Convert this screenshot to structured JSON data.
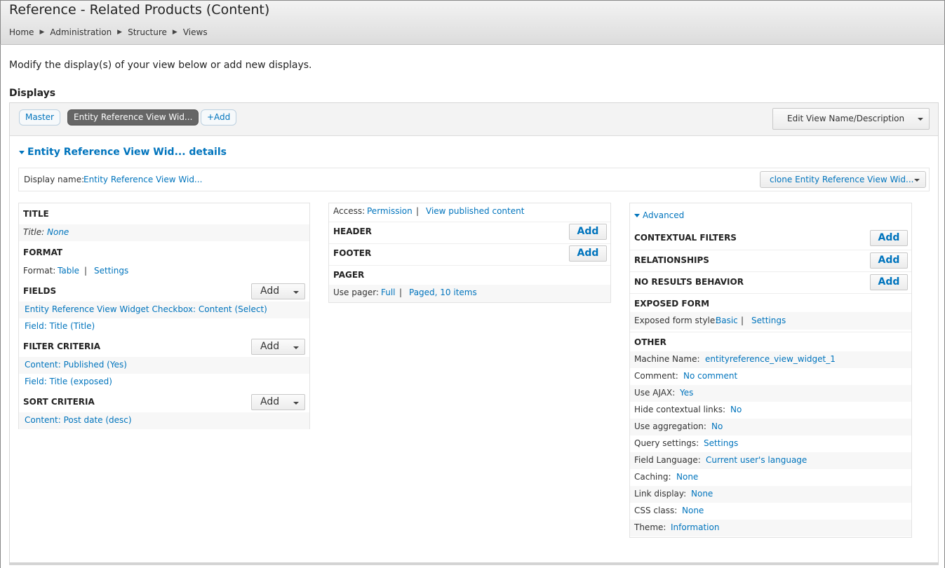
{
  "header": {
    "title": "Reference - Related Products (Content)",
    "breadcrumb": [
      "Home",
      "Administration",
      "Structure",
      "Views"
    ]
  },
  "intro": "Modify the display(s) of your view below or add new displays.",
  "displays_heading": "Displays",
  "tabs": {
    "master": "Master",
    "active": "Entity Reference View Wid...",
    "add": "+Add"
  },
  "edit_view_button": "Edit View Name/Description",
  "details_toggle": "Entity Reference View Wid... details",
  "display_name": {
    "label": "Display name:",
    "value": "Entity Reference View Wid...",
    "clone_button": "clone Entity Reference View Wid..."
  },
  "column1": {
    "title": {
      "heading": "TITLE",
      "label": "Title:",
      "value": "None"
    },
    "format": {
      "heading": "FORMAT",
      "label": "Format:",
      "value": "Table",
      "sep": "|",
      "settings": "Settings"
    },
    "fields": {
      "heading": "FIELDS",
      "add": "Add",
      "items": [
        "Entity Reference View Widget Checkbox: Content (Select)",
        "Field: Title (Title)"
      ]
    },
    "filter": {
      "heading": "FILTER CRITERIA",
      "add": "Add",
      "items": [
        "Content: Published (Yes)",
        "Field: Title (exposed)"
      ]
    },
    "sort": {
      "heading": "SORT CRITERIA",
      "add": "Add",
      "items": [
        "Content: Post date (desc)"
      ]
    }
  },
  "column2": {
    "access": {
      "label": "Access:",
      "value": "Permission",
      "sep": "|",
      "value2": "View published content"
    },
    "header": {
      "heading": "HEADER",
      "add": "Add"
    },
    "footer": {
      "heading": "FOOTER",
      "add": "Add"
    },
    "pager": {
      "heading": "PAGER",
      "label": "Use pager:",
      "value": "Full",
      "sep": "|",
      "value2": "Paged, 10 items"
    }
  },
  "column3": {
    "advanced": "Advanced",
    "contextual": {
      "heading": "CONTEXTUAL FILTERS",
      "add": "Add"
    },
    "relationships": {
      "heading": "RELATIONSHIPS",
      "add": "Add"
    },
    "no_results": {
      "heading": "NO RESULTS BEHAVIOR",
      "add": "Add"
    },
    "exposed": {
      "heading": "EXPOSED FORM",
      "label": "Exposed form style:",
      "value": "Basic",
      "sep": "|",
      "settings": "Settings"
    },
    "other": {
      "heading": "OTHER",
      "items": [
        {
          "label": "Machine Name:",
          "value": "entityreference_view_widget_1"
        },
        {
          "label": "Comment:",
          "value": "No comment"
        },
        {
          "label": "Use AJAX:",
          "value": "Yes"
        },
        {
          "label": "Hide contextual links:",
          "value": "No"
        },
        {
          "label": "Use aggregation:",
          "value": "No"
        },
        {
          "label": "Query settings:",
          "value": "Settings"
        },
        {
          "label": "Field Language:",
          "value": "Current user's language"
        },
        {
          "label": "Caching:",
          "value": "None"
        },
        {
          "label": "Link display:",
          "value": "None"
        },
        {
          "label": "CSS class:",
          "value": "None"
        },
        {
          "label": "Theme:",
          "value": "Information"
        }
      ]
    }
  }
}
